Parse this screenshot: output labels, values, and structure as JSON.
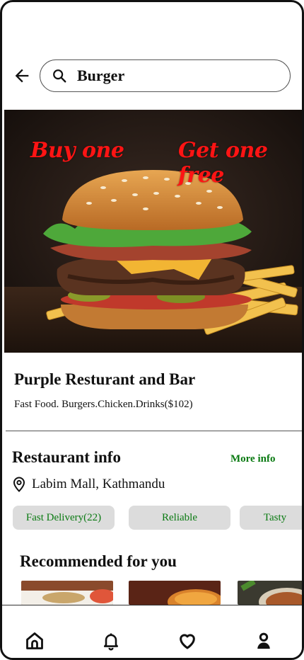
{
  "search": {
    "value": "Burger"
  },
  "hero": {
    "promo_left": "Buy one",
    "promo_right": "Get one free"
  },
  "restaurant": {
    "name": "Purple Resturant and Bar",
    "tags": "Fast Food. Burgers.Chicken.Drinks($102)"
  },
  "info": {
    "title": "Restaurant info",
    "more_link": "More info",
    "location": "Labim Mall, Kathmandu",
    "chips": [
      "Fast Delivery(22)",
      "Reliable",
      "Tasty"
    ]
  },
  "recommended": {
    "title": "Recommended for you"
  },
  "colors": {
    "promo": "#ff1414",
    "accent_green": "#0a7a12",
    "chip_bg": "#dcdcdc"
  },
  "icons": [
    "back-arrow-icon",
    "search-icon",
    "location-pin-icon",
    "home-icon",
    "bell-icon",
    "heart-icon",
    "profile-icon"
  ]
}
